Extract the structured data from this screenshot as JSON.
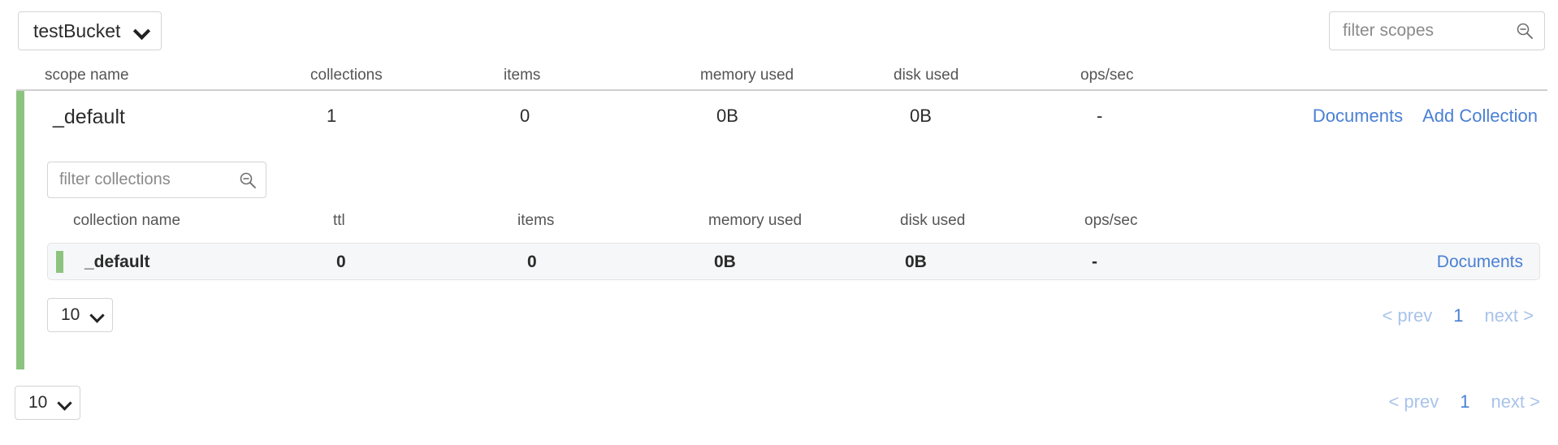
{
  "toolbar": {
    "bucket_label": "testBucket",
    "bucket_chevron_icon": "chevron-down-icon",
    "filter_scopes_placeholder": "filter scopes",
    "filter_scopes_value": "",
    "search_icon": "search-icon"
  },
  "scope_table": {
    "columns": [
      "scope name",
      "collections",
      "items",
      "memory used",
      "disk used",
      "ops/sec"
    ],
    "rows": [
      {
        "name": "_default",
        "collections": "1",
        "items": "0",
        "memory_used": "0B",
        "disk_used": "0B",
        "ops_sec": "-",
        "documents_link": "Documents",
        "add_collection_link": "Add Collection"
      }
    ]
  },
  "collections_panel": {
    "filter_placeholder": "filter collections",
    "filter_value": "",
    "search_icon": "search-icon",
    "columns": [
      "collection name",
      "ttl",
      "items",
      "memory used",
      "disk used",
      "ops/sec"
    ],
    "rows": [
      {
        "name": "_default",
        "ttl": "0",
        "items": "0",
        "memory_used": "0B",
        "disk_used": "0B",
        "ops_sec": "-",
        "documents_link": "Documents"
      }
    ],
    "pager": {
      "page_size": "10",
      "prev_label": "< prev",
      "page_label": "1",
      "next_label": "next >"
    }
  },
  "outer_pager": {
    "page_size": "10",
    "prev_label": "< prev",
    "page_label": "1",
    "next_label": "next >"
  },
  "colors": {
    "accent_green": "#8cc47f",
    "link_blue": "#4a80d4",
    "link_blue_muted": "#a9c3ea",
    "row_bg": "#f6f7f8",
    "border": "#d4d4d4"
  }
}
